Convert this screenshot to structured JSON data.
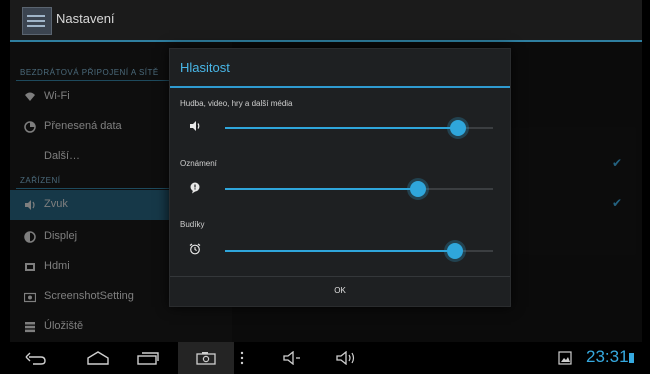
{
  "action_bar": {
    "title": "Nastavení",
    "icon": "settings-app-icon"
  },
  "settings_list": {
    "section_wireless": "BEZDRÁTOVÁ PŘIPOJENÍ A SÍTĚ",
    "section_device": "ZAŘÍZENÍ",
    "items": [
      {
        "label": "Wi-Fi",
        "icon": "wifi-icon"
      },
      {
        "label": "Přenesená data",
        "icon": "data-usage-icon"
      },
      {
        "label": "Další…",
        "icon": ""
      },
      {
        "label": "Zvuk",
        "icon": "sound-icon",
        "selected": true
      },
      {
        "label": "Displej",
        "icon": "display-icon"
      },
      {
        "label": "Hdmi",
        "icon": "hdmi-icon"
      },
      {
        "label": "ScreenshotSetting",
        "icon": "camera-icon"
      },
      {
        "label": "Úložiště",
        "icon": "storage-icon"
      }
    ]
  },
  "dialog": {
    "title": "Hlasitost",
    "sliders": [
      {
        "label": "Hudba, video, hry a další média",
        "icon": "speaker-icon",
        "value_percent": 87
      },
      {
        "label": "Oznámení",
        "icon": "notification-icon",
        "value_percent": 72
      },
      {
        "label": "Budíky",
        "icon": "alarm-icon",
        "value_percent": 86
      }
    ],
    "ok_label": "OK"
  },
  "status_bar": {
    "time": "23:31"
  },
  "colors": {
    "accent": "#2fa6db",
    "title": "#49b7e8",
    "selected": "#1f5e7b"
  }
}
